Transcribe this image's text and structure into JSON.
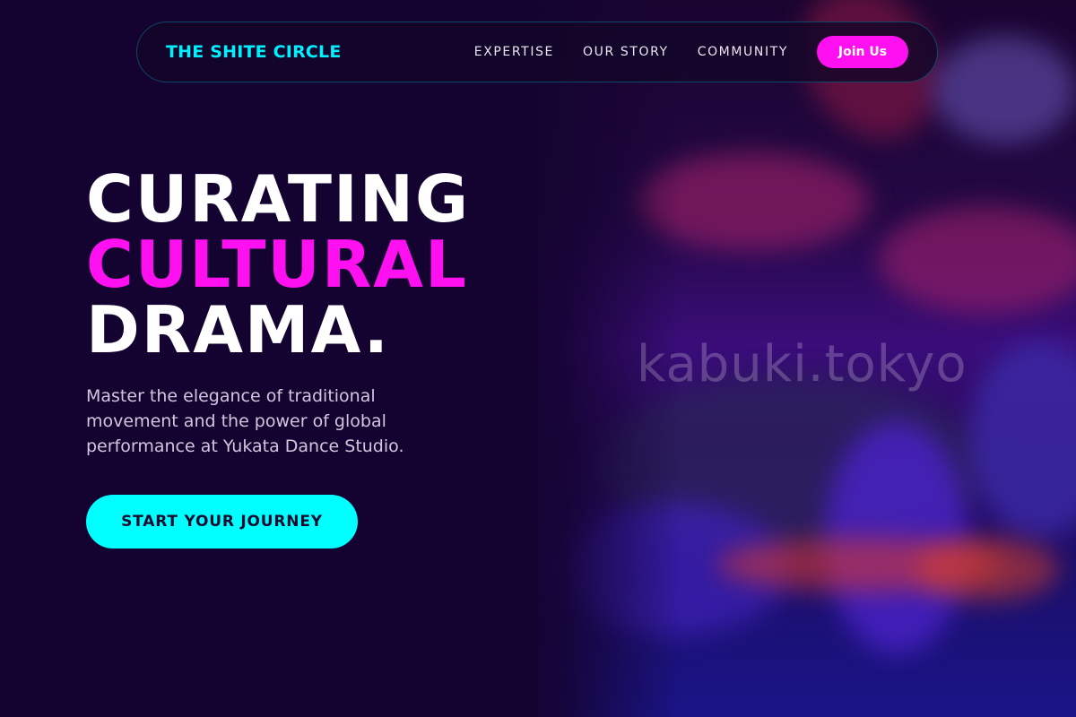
{
  "nav": {
    "brand": "THE SHITE CIRCLE",
    "links": [
      "EXPERTISE",
      "OUR STORY",
      "COMMUNITY"
    ],
    "cta_label": "Join Us"
  },
  "hero": {
    "headline": {
      "line1": "CURATING",
      "line2": "CULTURAL",
      "line3": "DRAMA."
    },
    "subtext": "Master the elegance of traditional movement and the power of global performance at Yukata Dance Studio.",
    "cta_label": "START YOUR JOURNEY",
    "image_watermark": "kabuki.tokyo"
  },
  "colors": {
    "background": "#140330",
    "accent_cyan": "#00ffff",
    "accent_magenta": "#ff10f0"
  }
}
